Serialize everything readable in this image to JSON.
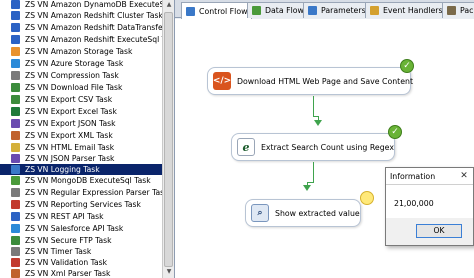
{
  "toolbox": {
    "items": [
      {
        "label": "ZS VN Amazon DynamoDB ExecuteSq",
        "color": "#2b62c4",
        "selected": false
      },
      {
        "label": "ZS VN Amazon Redshift Cluster Task",
        "color": "#2b62c4",
        "selected": false
      },
      {
        "label": "ZS VN Amazon Redshift DataTransfer",
        "color": "#2b62c4",
        "selected": false
      },
      {
        "label": "ZS VN Amazon Redshift ExecuteSql T",
        "color": "#2b62c4",
        "selected": false
      },
      {
        "label": "ZS VN Amazon Storage Task",
        "color": "#e8922e",
        "selected": false
      },
      {
        "label": "ZS VN Azure Storage Task",
        "color": "#2b8ad8",
        "selected": false
      },
      {
        "label": "ZS VN Compression Task",
        "color": "#7a7a7a",
        "selected": false
      },
      {
        "label": "ZS VN Download File Task",
        "color": "#3c8c3c",
        "selected": false
      },
      {
        "label": "ZS VN Export CSV Task",
        "color": "#3c8c3c",
        "selected": false
      },
      {
        "label": "ZS VN Export Excel Task",
        "color": "#1f7a3a",
        "selected": false
      },
      {
        "label": "ZS VN Export JSON Task",
        "color": "#6a4bb0",
        "selected": false
      },
      {
        "label": "ZS VN Export XML Task",
        "color": "#c0622e",
        "selected": false
      },
      {
        "label": "ZS VN HTML Email Task",
        "color": "#d4b03a",
        "selected": false
      },
      {
        "label": "ZS VN JSON Parser Task",
        "color": "#6a4bb0",
        "selected": false
      },
      {
        "label": "ZS VN Logging Task",
        "color": "#3a78c8",
        "selected": true
      },
      {
        "label": "ZS VN MongoDB ExecuteSql Task",
        "color": "#4a9a3a",
        "selected": false
      },
      {
        "label": "ZS VN Regular Expression Parser Task",
        "color": "#7a7a7a",
        "selected": false
      },
      {
        "label": "ZS VN Reporting Services Task",
        "color": "#c23a2e",
        "selected": false
      },
      {
        "label": "ZS VN REST API Task",
        "color": "#2b62c4",
        "selected": false
      },
      {
        "label": "ZS VN Salesforce API Task",
        "color": "#2b8ad8",
        "selected": false
      },
      {
        "label": "ZS VN Secure FTP Task",
        "color": "#3c8c3c",
        "selected": false
      },
      {
        "label": "ZS VN Timer Task",
        "color": "#7a7a7a",
        "selected": false
      },
      {
        "label": "ZS VN Validation Task",
        "color": "#c23a2e",
        "selected": false
      },
      {
        "label": "ZS VN Xml Parser Task",
        "color": "#c0622e",
        "selected": false
      }
    ]
  },
  "designer": {
    "tabs": [
      {
        "label": "Control Flow",
        "icon": "control-flow-icon",
        "active": true
      },
      {
        "label": "Data Flow",
        "icon": "data-flow-icon",
        "active": false
      },
      {
        "label": "Parameters",
        "icon": "parameters-icon",
        "active": false
      },
      {
        "label": "Event Handlers",
        "icon": "event-handlers-icon",
        "active": false
      },
      {
        "label": "Packa",
        "icon": "package-explorer-icon",
        "active": false
      }
    ],
    "tasks": {
      "download": {
        "label": "Download HTML Web Page and Save Content",
        "icon": "code-icon",
        "status": "success"
      },
      "regex": {
        "label": "Extract Search Count using Regex",
        "icon": "regex-icon",
        "status": "success"
      },
      "show": {
        "label": "Show extracted value",
        "icon": "magnifier-icon",
        "status": "running"
      }
    }
  },
  "messagebox": {
    "title": "Information",
    "text": "21,00,000",
    "ok_label": "OK"
  },
  "colors": {
    "selection": "#0a246a",
    "success": "#69b336",
    "connector": "#3fa34d"
  }
}
